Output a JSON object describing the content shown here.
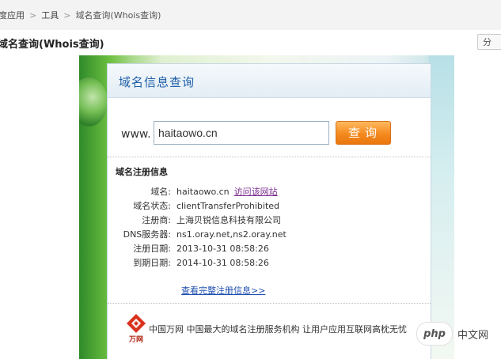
{
  "breadcrumb": {
    "items": [
      "度应用",
      "工具",
      "域名查询(Whois查询)"
    ],
    "separator": ">"
  },
  "page_title": "域名查询(Whois查询)",
  "share_button": "分",
  "card": {
    "header": "域名信息查询",
    "www_label": "www.",
    "input_value": "haitaowo.cn",
    "query_button": "查询",
    "info_title": "域名注册信息",
    "rows": [
      {
        "label": "域名:",
        "value": "haitaowo.cn"
      },
      {
        "label": "域名状态:",
        "value": "clientTransferProhibited"
      },
      {
        "label": "注册商:",
        "value": "上海贝锐信息科技有限公司"
      },
      {
        "label": "DNS服务器:",
        "value": "ns1.oray.net,ns2.oray.net"
      },
      {
        "label": "注册日期:",
        "value": "2013-10-31 08:58:26"
      },
      {
        "label": "到期日期:",
        "value": "2014-10-31 08:58:26"
      }
    ],
    "visit_link": "访问该网站",
    "more_link": "查看完整注册信息>>",
    "brand_name": "中国万网",
    "brand_slogan": "中国最大的域名注册服务机构 让用户应用互联网高枕无忧",
    "brand_logo_text": "万网"
  },
  "watermark": {
    "badge": "php",
    "text": "中文网"
  },
  "colors": {
    "accent_blue": "#1f5fa8",
    "button_orange": "#f48a1f",
    "link_purple": "#7a2a8f"
  }
}
